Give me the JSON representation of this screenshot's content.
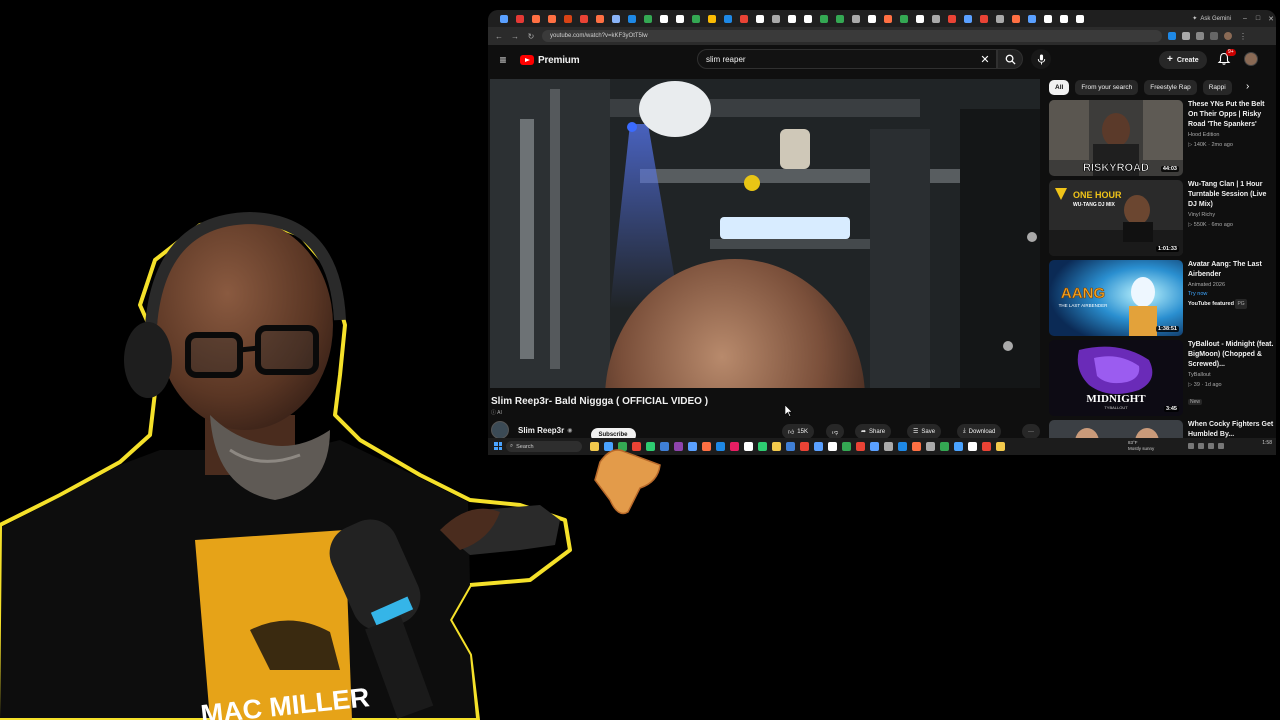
{
  "browser": {
    "url": "youtube.com/watch?v=kKF3yOtT5lw",
    "ask_gemini": "Ask Gemini",
    "tab_colors": [
      "#5aa0ff",
      "#e53935",
      "#ff7043",
      "#ff7043",
      "#d84315",
      "#ea4335",
      "#ff7043",
      "#8ab4f8",
      "#1e88e5",
      "#34a853",
      "#ffffff",
      "#ffffff",
      "#34a853",
      "#fbbc04",
      "#1e88e5",
      "#ea4335",
      "#ffffff",
      "#aaaaaa",
      "#ffffff",
      "#ffffff",
      "#34a853",
      "#34a853",
      "#aaaaaa",
      "#ffffff",
      "#ff7043",
      "#34a853",
      "#ffffff",
      "#aaaaaa",
      "#ea4335",
      "#5aa0ff",
      "#ea4335",
      "#aaaaaa",
      "#ff7043",
      "#5aa0ff",
      "#ffffff",
      "#ffffff",
      "#ffffff"
    ]
  },
  "youtube": {
    "logo_text": "Premium",
    "search_query": "slim reaper",
    "create_label": "Create",
    "notif_count": "9+",
    "video": {
      "title": "Slim Reep3r- Bald Niggga ( OFFICIAL VIDEO )",
      "ai_badge": "AI",
      "channel": "Slim Reep3r",
      "subscribe": "Subscribe",
      "likes": "15K",
      "share": "Share",
      "save": "Save",
      "download": "Download",
      "more": "···"
    },
    "chips": [
      "All",
      "From your search",
      "Freestyle Rap",
      "Rappi"
    ],
    "recommendations": [
      {
        "title": "These YNs Put the Belt On Their Opps | Risky Road 'The Spankers'",
        "channel": "Hood Edition",
        "meta": "▷ 140K · 2mo ago",
        "duration": "44:03",
        "thumb_text": "RISKYROAD"
      },
      {
        "title": "Wu-Tang Clan | 1 Hour Turntable Session (Live DJ Mix)",
        "channel": "Vinyl Richy",
        "meta": "▷ 550K · 6mo ago",
        "duration": "1:01:33",
        "thumb_text": "ONE HOUR",
        "thumb_sub": "WU-TANG DJ MIX"
      },
      {
        "title": "Avatar Aang: The Last Airbender",
        "channel": "Animated 2026",
        "try": "Try now",
        "meta": "YouTube featured",
        "tag": "PG",
        "duration": "1:38:51",
        "thumb_text": "AANG",
        "thumb_sub": "THE LAST AIRBENDER"
      },
      {
        "title": "TyBallout - Midnight (feat. BigMoon) (Chopped & Screwed)...",
        "channel": "TyBallout",
        "meta": "▷ 39 · 1d ago",
        "tag": "New",
        "duration": "3:45",
        "thumb_text": "MIDNIGHT",
        "thumb_sub": "TYBALLOUT"
      },
      {
        "title": "When Cocky Fighters Get Humbled By..."
      }
    ]
  },
  "taskbar": {
    "search_placeholder": "Search",
    "weather_temp": "83°F",
    "weather_desc": "Mostly sunny",
    "time": "1:58"
  },
  "webcam": {
    "shirt_text": "MAC MILLER"
  },
  "colors": {
    "outline": "#f5e12a",
    "yt_red": "#ff0000",
    "link_blue": "#3ea6ff"
  }
}
